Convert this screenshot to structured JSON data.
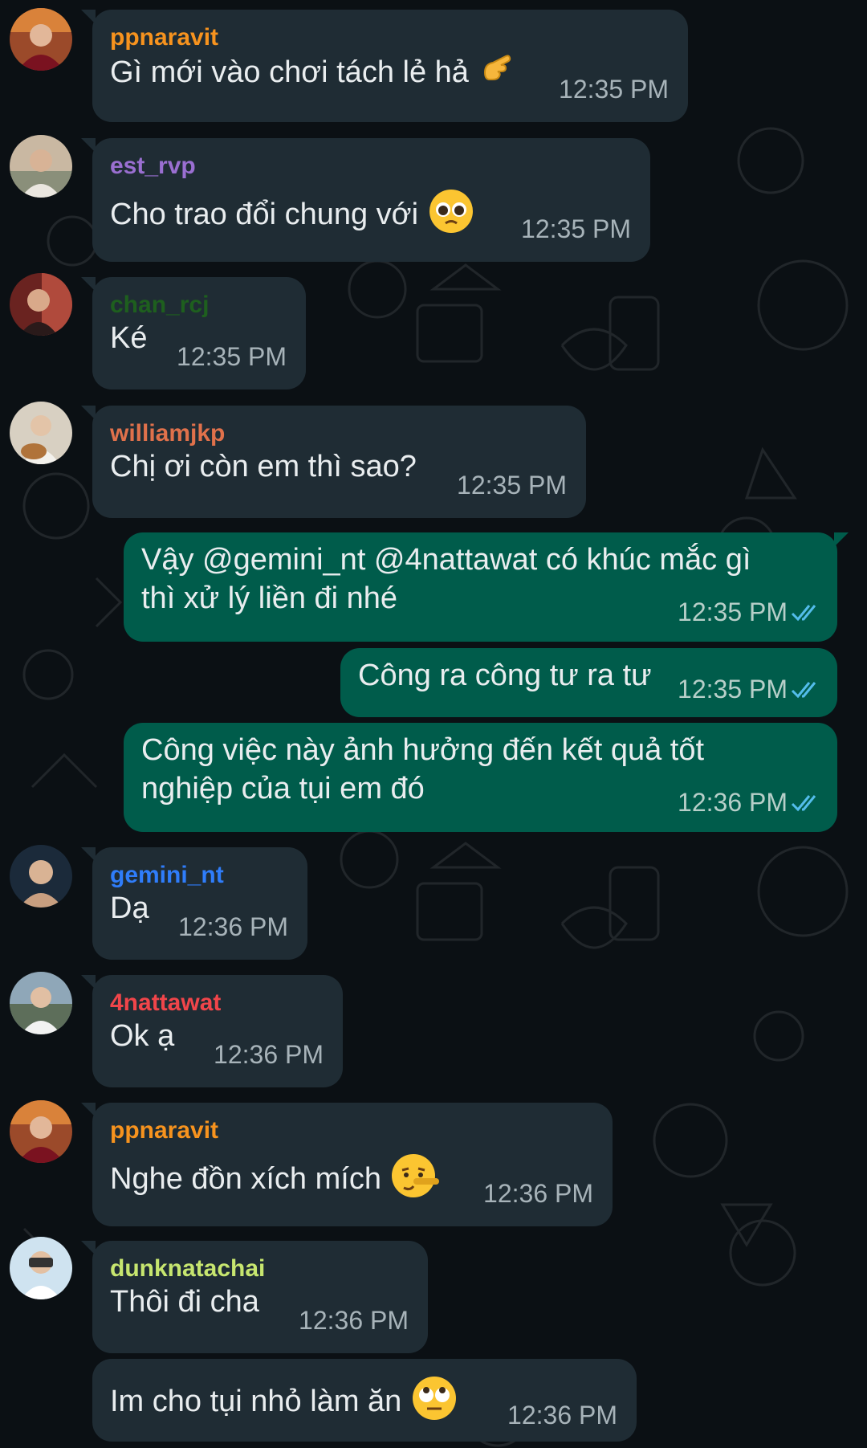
{
  "colors": {
    "background": "#0b1014",
    "incoming_bubble": "#1f2c34",
    "outgoing_bubble": "#005c4b",
    "read_ticks": "#53bdeb"
  },
  "messages": [
    {
      "sender": "ppnaravit",
      "sender_color": "#f7931e",
      "text": "Gì mới vào chơi tách lẻ hả",
      "emoji": "pointing-hand-icon",
      "time": "12:35 PM"
    },
    {
      "sender": "est_rvp",
      "sender_color": "#9a6fd1",
      "text": "Cho trao đổi chung với",
      "emoji": "pleading-face-icon",
      "time": "12:35 PM"
    },
    {
      "sender": "chan_rcj",
      "sender_color": "#1e5f1e",
      "text": "Ké",
      "time": "12:35 PM"
    },
    {
      "sender": "williamjkp",
      "sender_color": "#e0714b",
      "text": "Chị ơi còn em thì sao?",
      "time": "12:35 PM"
    },
    {
      "outgoing": true,
      "text": "Vậy @gemini_nt @4nattawat có khúc mắc gì thì xử lý liền đi nhé",
      "time": "12:35 PM",
      "status": "read"
    },
    {
      "outgoing": true,
      "text": "Công ra công tư ra tư",
      "time": "12:35 PM",
      "status": "read"
    },
    {
      "outgoing": true,
      "text": "Công việc này ảnh hưởng đến kết quả tốt nghiệp của tụi em đó",
      "time": "12:36 PM",
      "status": "read"
    },
    {
      "sender": "gemini_nt",
      "sender_color": "#2f7dfa",
      "text": "Dạ",
      "time": "12:36 PM"
    },
    {
      "sender": "4nattawat",
      "sender_color": "#f0454a",
      "text": "Ok ạ",
      "time": "12:36 PM"
    },
    {
      "sender": "ppnaravit",
      "sender_color": "#f7931e",
      "text": "Nghe đồn xích mích",
      "emoji": "lying-face-icon",
      "time": "12:36 PM"
    },
    {
      "sender": "dunknatachai",
      "sender_color": "#c7e66f",
      "text": "Thôi đi cha",
      "time": "12:36 PM"
    },
    {
      "text": "Im cho tụi nhỏ làm ăn",
      "emoji": "eye-roll-face-icon",
      "time": "12:36 PM"
    }
  ]
}
